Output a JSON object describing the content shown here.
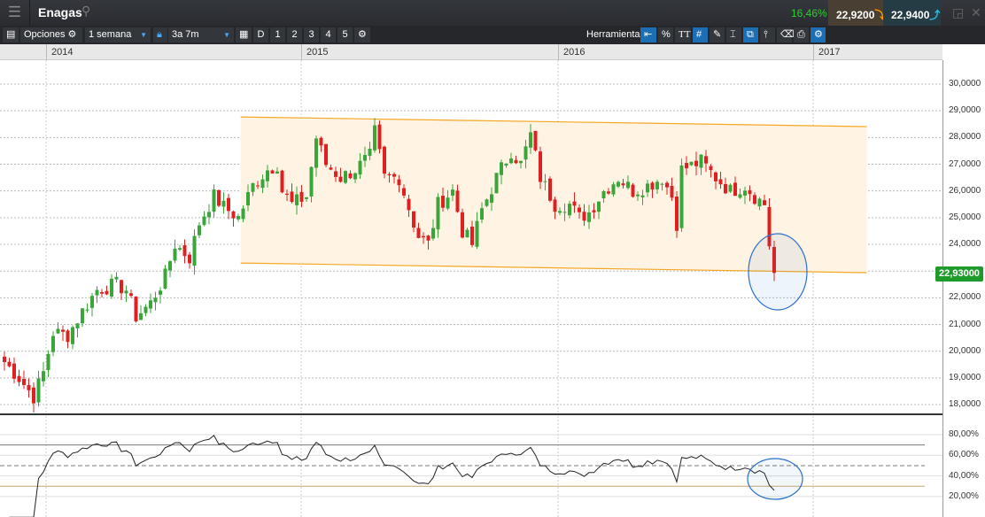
{
  "header": {
    "menu_icon": "hamburger-icon",
    "title": "Enagas",
    "search_icon": "search-icon",
    "change_pct": "16,46%",
    "bid": "22,9200",
    "ask": "22,9400",
    "bid_arrow": "⤵",
    "ask_arrow": "⤴"
  },
  "toolbar": {
    "options_label": "Opciones",
    "interval": "1 semana",
    "range": "3a 7m",
    "presets": [
      "D",
      "1",
      "2",
      "3",
      "4",
      "5"
    ],
    "tools_label": "Herramientas",
    "tool_pct": "%",
    "tool_text": "TT"
  },
  "chart_data": {
    "type": "candlestick",
    "x_tick_labels": [
      "2014",
      "2015",
      "2016",
      "2017"
    ],
    "y_tick_labels": [
      "30,0000",
      "29,0000",
      "28,0000",
      "27,0000",
      "26,0000",
      "25,0000",
      "24,0000",
      "23,0000",
      "22,0000",
      "21,0000",
      "20,0000",
      "19,0000",
      "18,0000"
    ],
    "ylim": [
      17.6,
      30.5
    ],
    "last_price_label": "22,93000",
    "weekly_close_path_week_price": [
      [
        0,
        19.6
      ],
      [
        3,
        19.0
      ],
      [
        6,
        18.3
      ],
      [
        8,
        19.2
      ],
      [
        10,
        20.7
      ],
      [
        13,
        20.6
      ],
      [
        16,
        21.5
      ],
      [
        19,
        22.3
      ],
      [
        23,
        22.5
      ],
      [
        25,
        22.3
      ],
      [
        27,
        21.3
      ],
      [
        30,
        21.8
      ],
      [
        33,
        22.8
      ],
      [
        35,
        24.0
      ],
      [
        38,
        23.5
      ],
      [
        40,
        24.8
      ],
      [
        43,
        25.8
      ],
      [
        45,
        25.4
      ],
      [
        48,
        25.0
      ],
      [
        51,
        26.2
      ],
      [
        54,
        26.8
      ],
      [
        56,
        27.0
      ],
      [
        57,
        26.0
      ],
      [
        59,
        25.5
      ],
      [
        62,
        25.8
      ],
      [
        64,
        28.0
      ],
      [
        66,
        27.0
      ],
      [
        69,
        26.5
      ],
      [
        72,
        26.8
      ],
      [
        75,
        27.3
      ],
      [
        76,
        28.2
      ],
      [
        78,
        26.5
      ],
      [
        81,
        26.5
      ],
      [
        84,
        24.8
      ],
      [
        85,
        24.3
      ],
      [
        87,
        24.0
      ],
      [
        89,
        25.5
      ],
      [
        92,
        26.0
      ],
      [
        94,
        24.5
      ],
      [
        96,
        24.0
      ],
      [
        98,
        25.3
      ],
      [
        101,
        26.5
      ],
      [
        104,
        27.5
      ],
      [
        106,
        27.0
      ],
      [
        108,
        28.1
      ],
      [
        110,
        26.5
      ],
      [
        113,
        25.5
      ],
      [
        116,
        25.5
      ],
      [
        118,
        25.0
      ],
      [
        120,
        25.2
      ],
      [
        123,
        26.0
      ],
      [
        126,
        26.5
      ],
      [
        129,
        26.0
      ],
      [
        132,
        26.2
      ],
      [
        135,
        26.5
      ],
      [
        137,
        25.8
      ],
      [
        138,
        24.8
      ],
      [
        139,
        26.8
      ],
      [
        143,
        27.1
      ],
      [
        146,
        26.5
      ],
      [
        149,
        26.0
      ],
      [
        152,
        26.2
      ],
      [
        154,
        25.8
      ],
      [
        156,
        25.5
      ],
      [
        157,
        24.0
      ],
      [
        158,
        22.93
      ]
    ],
    "channel": {
      "upper": [
        [
          48.5,
          28.77
        ],
        [
          177,
          28.41
        ]
      ],
      "lower": [
        [
          48.5,
          23.3
        ],
        [
          177,
          22.94
        ]
      ]
    },
    "rsi": {
      "period": 14,
      "y_tick_labels": [
        "80,00%",
        "60,00%",
        "40,00%",
        "20,00%"
      ],
      "levels": [
        70,
        50,
        30
      ]
    },
    "colors": {
      "up": "#3aa63a",
      "down": "#e02020",
      "channel": "#f5a623",
      "channel_fill": "#fff3e3",
      "highlight": "#2a6fcf"
    }
  }
}
